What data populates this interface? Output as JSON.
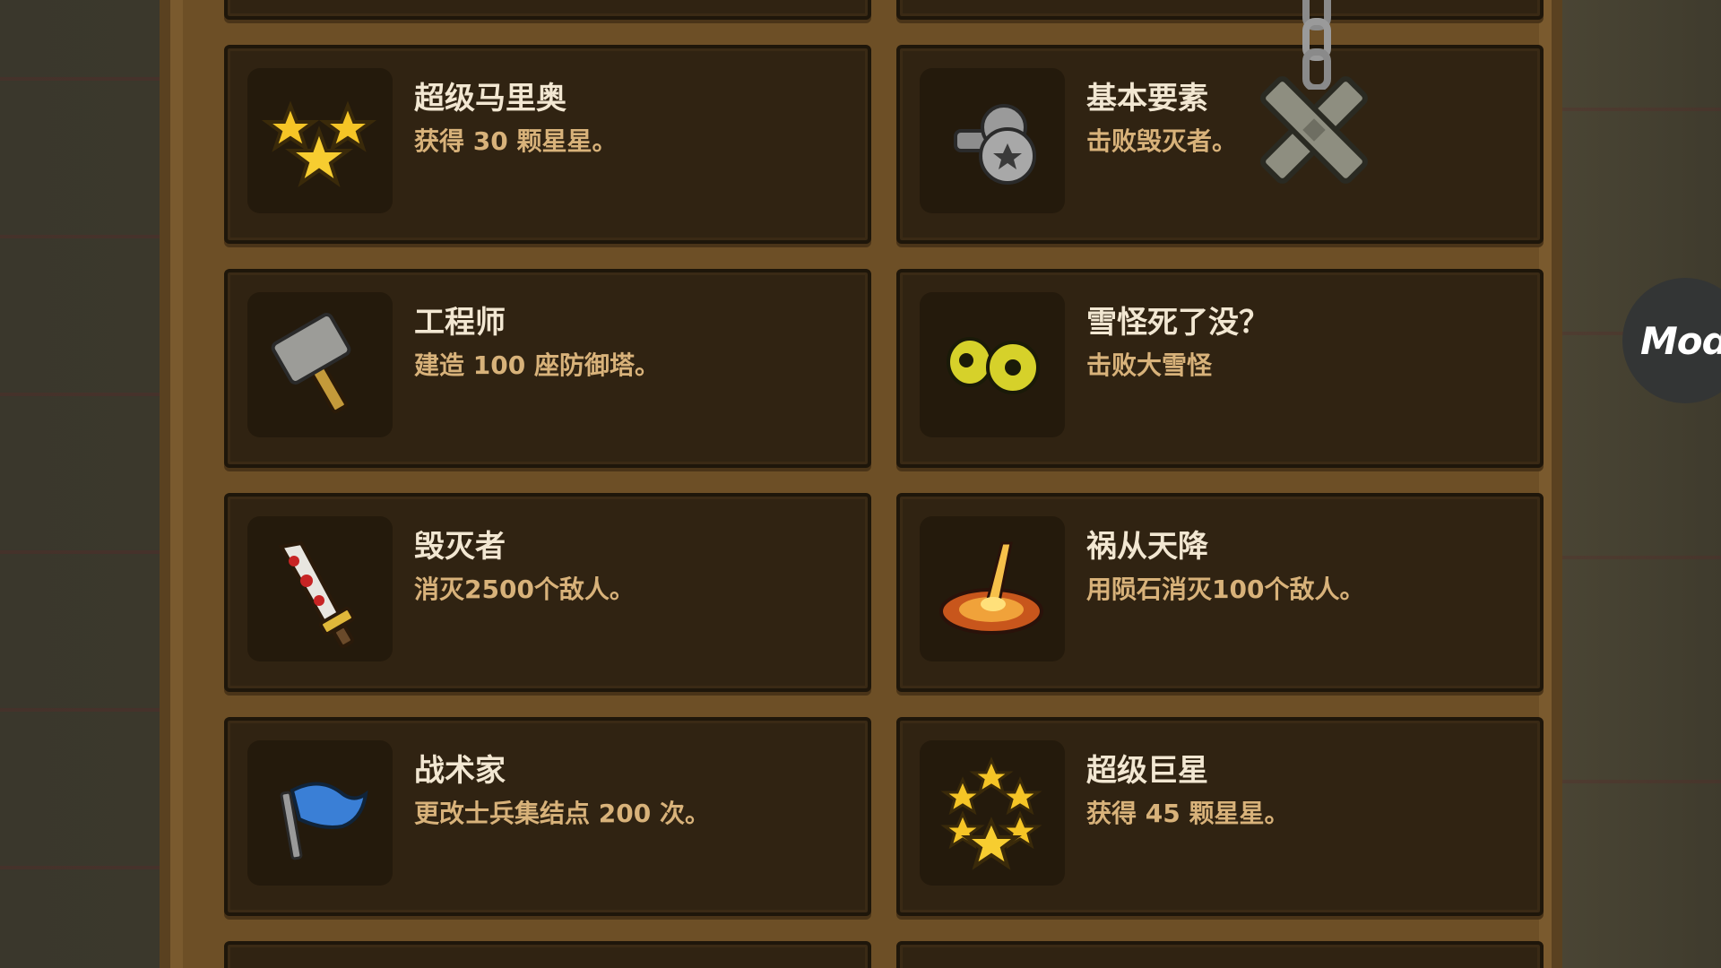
{
  "achievements": [
    {
      "title": "超级马里奥",
      "desc": "获得 30 颗星星。",
      "icon": "three-stars-icon"
    },
    {
      "title": "基本要素",
      "desc": "击败毁灭者。",
      "icon": "screws-icon"
    },
    {
      "title": "工程师",
      "desc": "建造 100 座防御塔。",
      "icon": "hammer-icon"
    },
    {
      "title": "雪怪死了没？",
      "desc": "击败大雪怪",
      "icon": "yeti-eyes-icon"
    },
    {
      "title": "毁灭者",
      "desc": "消灭2500个敌人。",
      "icon": "bloody-sword-icon"
    },
    {
      "title": "祸从天降",
      "desc": "用陨石消灭100个敌人。",
      "icon": "meteor-impact-icon"
    },
    {
      "title": "战术家",
      "desc": "更改士兵集结点 200 次。",
      "icon": "blue-flag-icon"
    },
    {
      "title": "超级巨星",
      "desc": "获得 45 颗星星。",
      "icon": "six-stars-icon"
    }
  ],
  "close_icon": "close-x-icon",
  "mod_button": {
    "label": "Mod"
  },
  "colors": {
    "card_bg": "#302312",
    "title": "#f2e7d2",
    "desc": "#d8b27a",
    "board": "#6d4f26"
  }
}
